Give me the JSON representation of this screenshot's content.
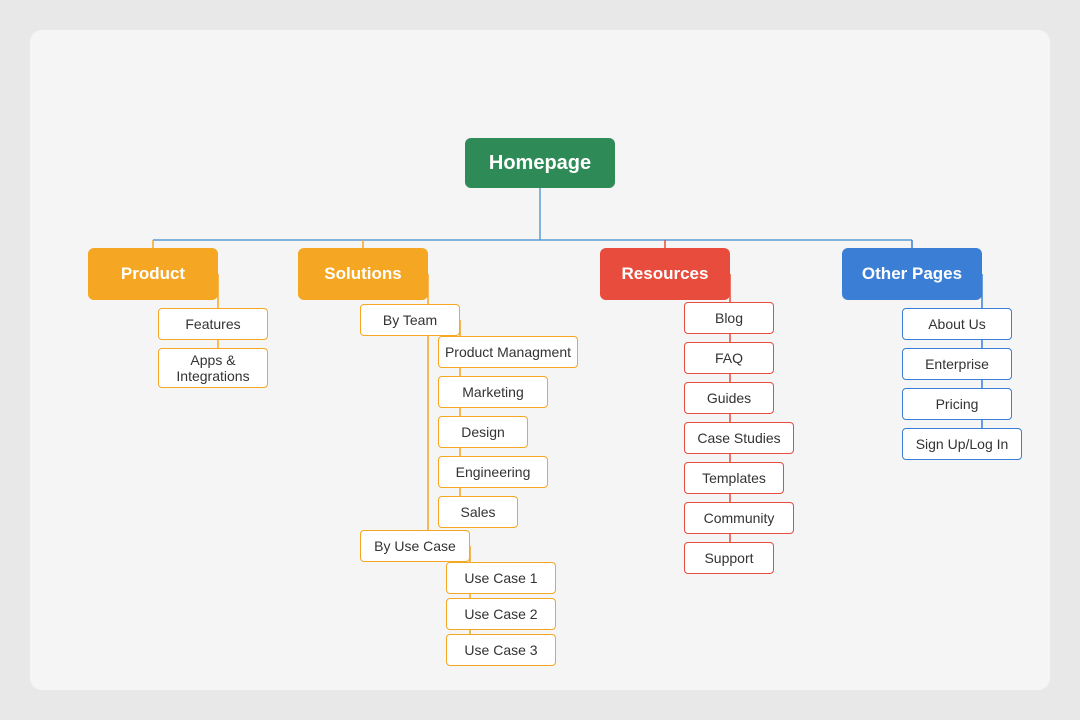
{
  "homepage": "Homepage",
  "product": "Product",
  "solutions": "Solutions",
  "resources": "Resources",
  "otherpages": "Other Pages",
  "features": "Features",
  "apps": "Apps & Integrations",
  "byteam": "By Team",
  "prodmgmt": "Product Managment",
  "marketing": "Marketing",
  "design": "Design",
  "engineering": "Engineering",
  "sales": "Sales",
  "byusecase": "By Use Case",
  "usecase1": "Use Case 1",
  "usecase2": "Use Case 2",
  "usecase3": "Use Case 3",
  "blog": "Blog",
  "faq": "FAQ",
  "guides": "Guides",
  "casestudies": "Case Studies",
  "templates": "Templates",
  "community": "Community",
  "support": "Support",
  "aboutus": "About Us",
  "enterprise": "Enterprise",
  "pricing": "Pricing",
  "signup": "Sign Up/Log In"
}
